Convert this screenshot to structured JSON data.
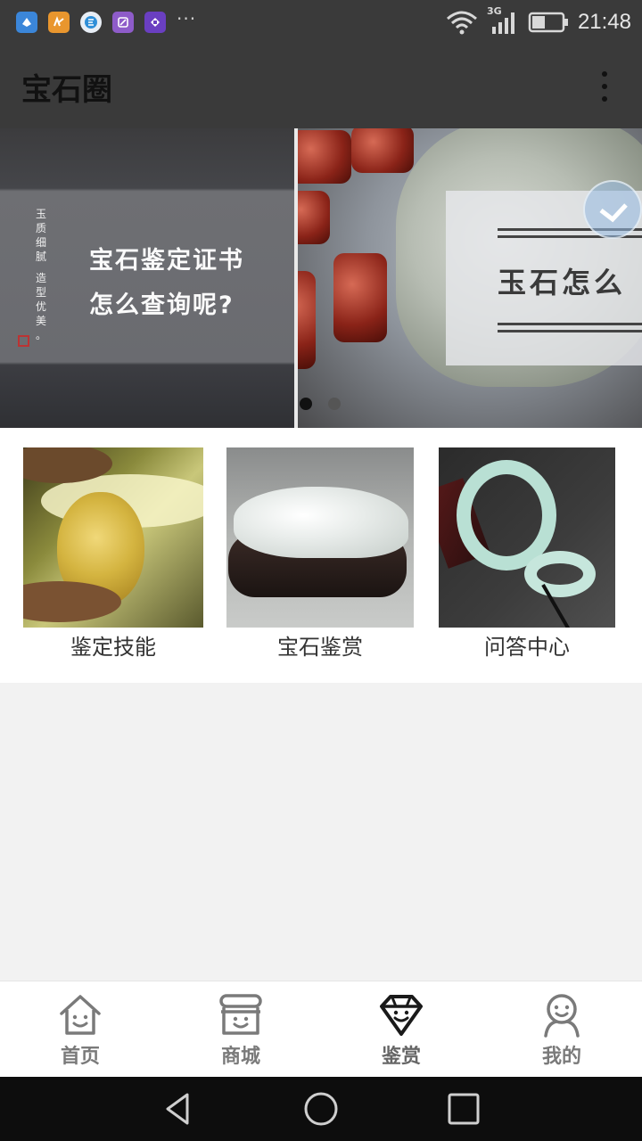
{
  "status_bar": {
    "time": "21:48",
    "network": "3G",
    "notifications": [
      {
        "icon": "app-blue-icon",
        "color": "#3b86d9"
      },
      {
        "icon": "app-orange-icon",
        "color": "#e9962e"
      },
      {
        "icon": "app-circle-e-icon",
        "color": "#2f8fd8"
      },
      {
        "icon": "app-purple-icon",
        "color": "#8e5cc9"
      },
      {
        "icon": "app-violet-icon",
        "color": "#6a3fc1"
      }
    ],
    "more_notifications": "···"
  },
  "app_bar": {
    "title": "宝石圈",
    "menu_icon": "more-vert-icon"
  },
  "banner": {
    "slides": [
      {
        "vertical_text_1": "玉质细腻",
        "vertical_text_2": "造型优美。",
        "line_1": "宝石鉴定证书",
        "line_2": "怎么查询呢?"
      },
      {
        "text": "玉石怎么"
      }
    ],
    "active_index": 0,
    "slide_count": 2
  },
  "categories": [
    {
      "label": "鉴定技能"
    },
    {
      "label": "宝石鉴赏"
    },
    {
      "label": "问答中心"
    }
  ],
  "bottom_nav": {
    "items": [
      {
        "label": "首页",
        "icon": "home-icon"
      },
      {
        "label": "商城",
        "icon": "store-icon"
      },
      {
        "label": "鉴赏",
        "icon": "diamond-icon",
        "active": true
      },
      {
        "label": "我的",
        "icon": "profile-icon"
      }
    ]
  },
  "colors": {
    "app_bar": "#3a3a3a",
    "background": "#f2f2f2",
    "nav_label": "#7a7a7a"
  }
}
